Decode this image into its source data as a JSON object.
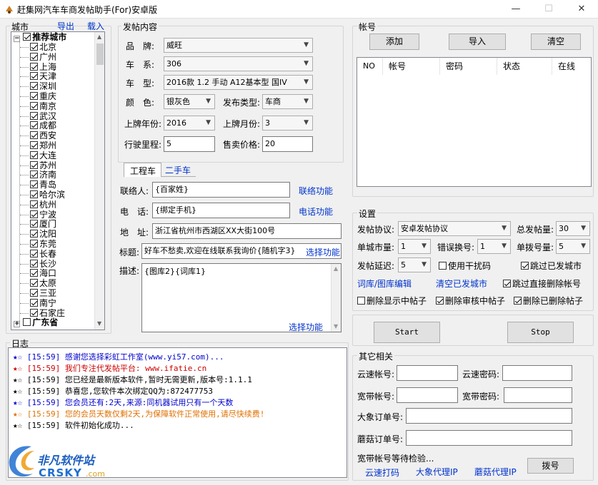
{
  "window": {
    "title": "赶集网汽车车商发帖助手(For)安卓版",
    "min": "—",
    "max": "☐",
    "close": "✕"
  },
  "city_panel": {
    "label": "城市",
    "export": "导出",
    "import": "载入",
    "root": "推荐城市",
    "cities": [
      "北京",
      "广州",
      "上海",
      "天津",
      "深圳",
      "重庆",
      "南京",
      "武汉",
      "成都",
      "西安",
      "郑州",
      "大连",
      "苏州",
      "济南",
      "青岛",
      "哈尔滨",
      "杭州",
      "宁波",
      "厦门",
      "沈阳",
      "东莞",
      "长春",
      "长沙",
      "海口",
      "太原",
      "三亚",
      "南宁",
      "石家庄"
    ],
    "next_group": "广东省"
  },
  "post": {
    "label": "发帖内容",
    "brand_label": "品　牌:",
    "brand": "威旺",
    "series_label": "车　系:",
    "series": "306",
    "model_label": "车　型:",
    "model": "2016款 1.2 手动 A12基本型 国IV",
    "color_label": "颜　色:",
    "color": "银灰色",
    "type_label": "发布类型:",
    "type": "车商",
    "year_label": "上牌年份:",
    "year": "2016",
    "month_label": "上牌月份:",
    "month": "3",
    "mileage_label": "行驶里程:",
    "mileage": "5",
    "price_label": "售卖价格:",
    "price": "20",
    "tabs": [
      "工程车",
      "二手车"
    ],
    "contact_label": "联络人:",
    "contact": "{百家姓}",
    "contact_link": "联络功能",
    "phone_label": "电　话:",
    "phone": "{绑定手机}",
    "phone_link": "电话功能",
    "addr_label": "地　址:",
    "addr": "浙江省杭州市西湖区XX大街100号",
    "title_label": "标题:",
    "title": "好车不愁卖,欢迎在线联系我询价{随机字3}",
    "title_link": "选择功能",
    "desc_label": "描述:",
    "desc": "{图库2}{词库1}",
    "desc_link": "选择功能"
  },
  "account": {
    "label": "帐号",
    "add": "添加",
    "import": "导入",
    "clear": "清空",
    "columns": [
      "NO",
      "帐号",
      "密码",
      "状态",
      "在线"
    ]
  },
  "settings": {
    "label": "设置",
    "protocol_label": "发帖协议:",
    "protocol": "安卓发帖协议",
    "total_label": "总发帖量:",
    "total": "30",
    "single_label": "单城市量:",
    "single": "1",
    "retry_label": "错误换号:",
    "retry": "1",
    "dial_label": "单拨号量:",
    "dial": "5",
    "delay_label": "发帖延迟:",
    "delay": "5",
    "captcha": "使用干扰码",
    "skip_sent": "跳过已发城市",
    "gallery_link": "词库/图库编辑",
    "sent_link": "清空已发城市",
    "skip_delete": "跳过直接删除帐号",
    "del_shown": "删除显示中帖子",
    "del_review": "删除审核中帖子",
    "del_deleted": "删除已删除帖子"
  },
  "controls": {
    "start": "Start",
    "stop": "Stop"
  },
  "other": {
    "label": "其它相关",
    "ys_acc": "云速帐号:",
    "ys_pwd": "云速密码:",
    "kd_acc": "宽带帐号:",
    "kd_pwd": "宽带密码:",
    "dx_order": "大象订单号:",
    "mg_order": "蘑菇订单号:",
    "wait": "宽带帐号等待检验...",
    "ys_code": "云速打码",
    "dx_ip": "大象代理IP",
    "mg_ip": "蘑菇代理IP",
    "dial": "拨号"
  },
  "log": {
    "label": "日志",
    "lines": [
      {
        "text": "[15:59] 感谢您选择彩虹工作室(www.yi57.com)...",
        "color": "#0000cc",
        "star": "#0000cc"
      },
      {
        "text": "[15:59] 我们专注代发帖平台: www.ifatie.cn",
        "color": "#cc0000",
        "star": "#cc0000"
      },
      {
        "text": "[15:59] 您已经是最新版本软件,暂时无需更新,版本号:1.1.1",
        "color": "#000000",
        "star": "#000000"
      },
      {
        "text": "[15:59] 恭喜您,您软件本次绑定QQ为:872477753",
        "color": "#000000",
        "star": "#000000"
      },
      {
        "text": "[15:59] 您会员还有:2天,来源:同机器试用只有一个天数",
        "color": "#0000cc",
        "star": "#0000cc"
      },
      {
        "text": "[15:59] 您的会员天数仅剩2天,为保障软件正常使用,请尽快续费!",
        "color": "#e07000",
        "star": "#e07000"
      },
      {
        "text": "[15:59] 软件初始化成功...",
        "color": "#000000",
        "star": "#000000"
      }
    ]
  },
  "watermark": {
    "cn": "非凡软件站",
    "en": "CRSKY",
    "suffix": ".com"
  }
}
